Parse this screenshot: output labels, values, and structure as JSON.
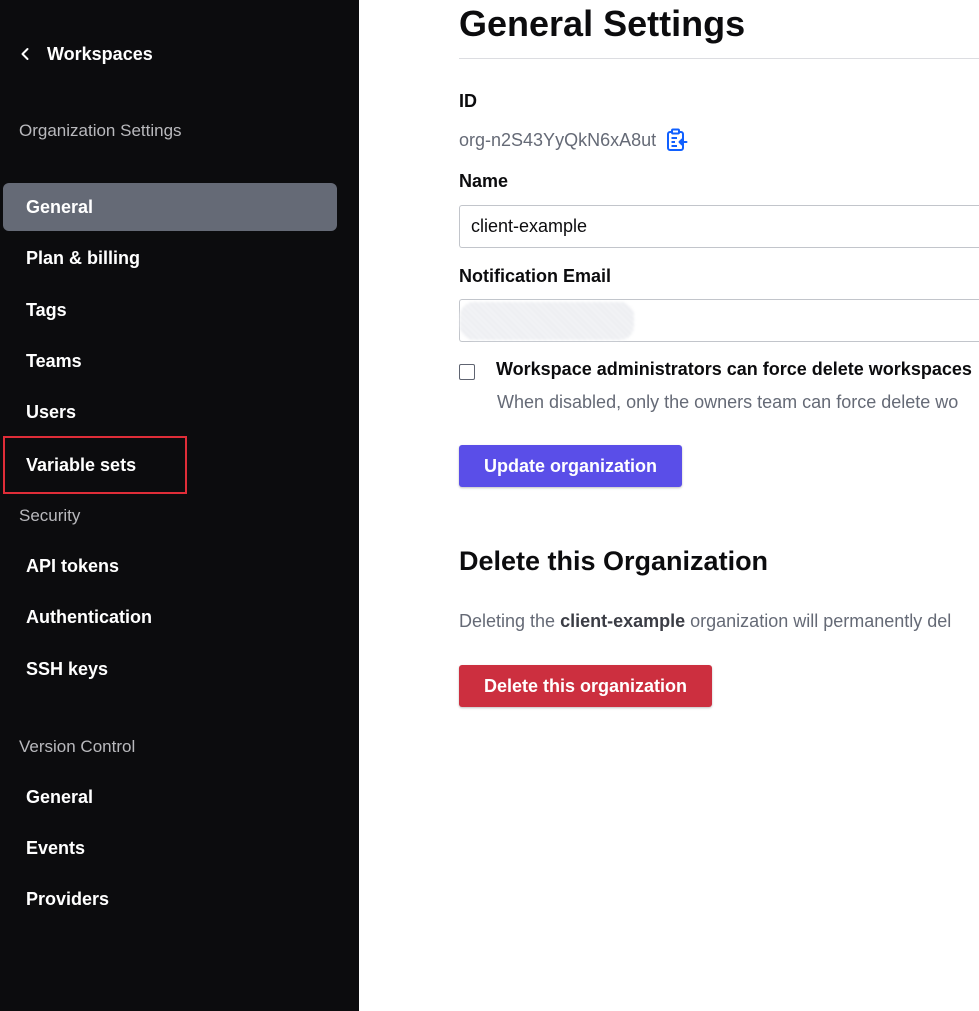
{
  "sidebar": {
    "back_label": "Workspaces",
    "sections": {
      "organization": "Organization Settings",
      "security": "Security",
      "version_control": "Version Control"
    },
    "org_items": [
      "General",
      "Plan & billing",
      "Tags",
      "Teams",
      "Users",
      "Variable sets"
    ],
    "security_items": [
      "API tokens",
      "Authentication",
      "SSH keys"
    ],
    "vcs_items": [
      "General",
      "Events",
      "Providers"
    ],
    "active_item": "General",
    "highlighted_item": "Variable sets"
  },
  "main": {
    "title": "General Settings",
    "id_label": "ID",
    "org_id": "org-n2S43YyQkN6xA8ut",
    "name_label": "Name",
    "name_value": "client-example",
    "email_label": "Notification Email",
    "force_delete_label": "Workspace administrators can force delete workspaces",
    "force_delete_help": "When disabled, only the owners team can force delete wo",
    "force_delete_checked": false,
    "update_button": "Update organization",
    "delete_section_title": "Delete this Organization",
    "delete_text_prefix": "Deleting the ",
    "delete_text_org": "client-example",
    "delete_text_suffix": " organization will permanently del",
    "delete_button": "Delete this organization"
  },
  "colors": {
    "sidebar_bg": "#0c0c0e",
    "active_item_bg": "#656a76",
    "highlight_border": "#e02d38",
    "primary": "#5a4ee8",
    "danger": "#cc2f3f",
    "copy_icon": "#1060ff"
  }
}
